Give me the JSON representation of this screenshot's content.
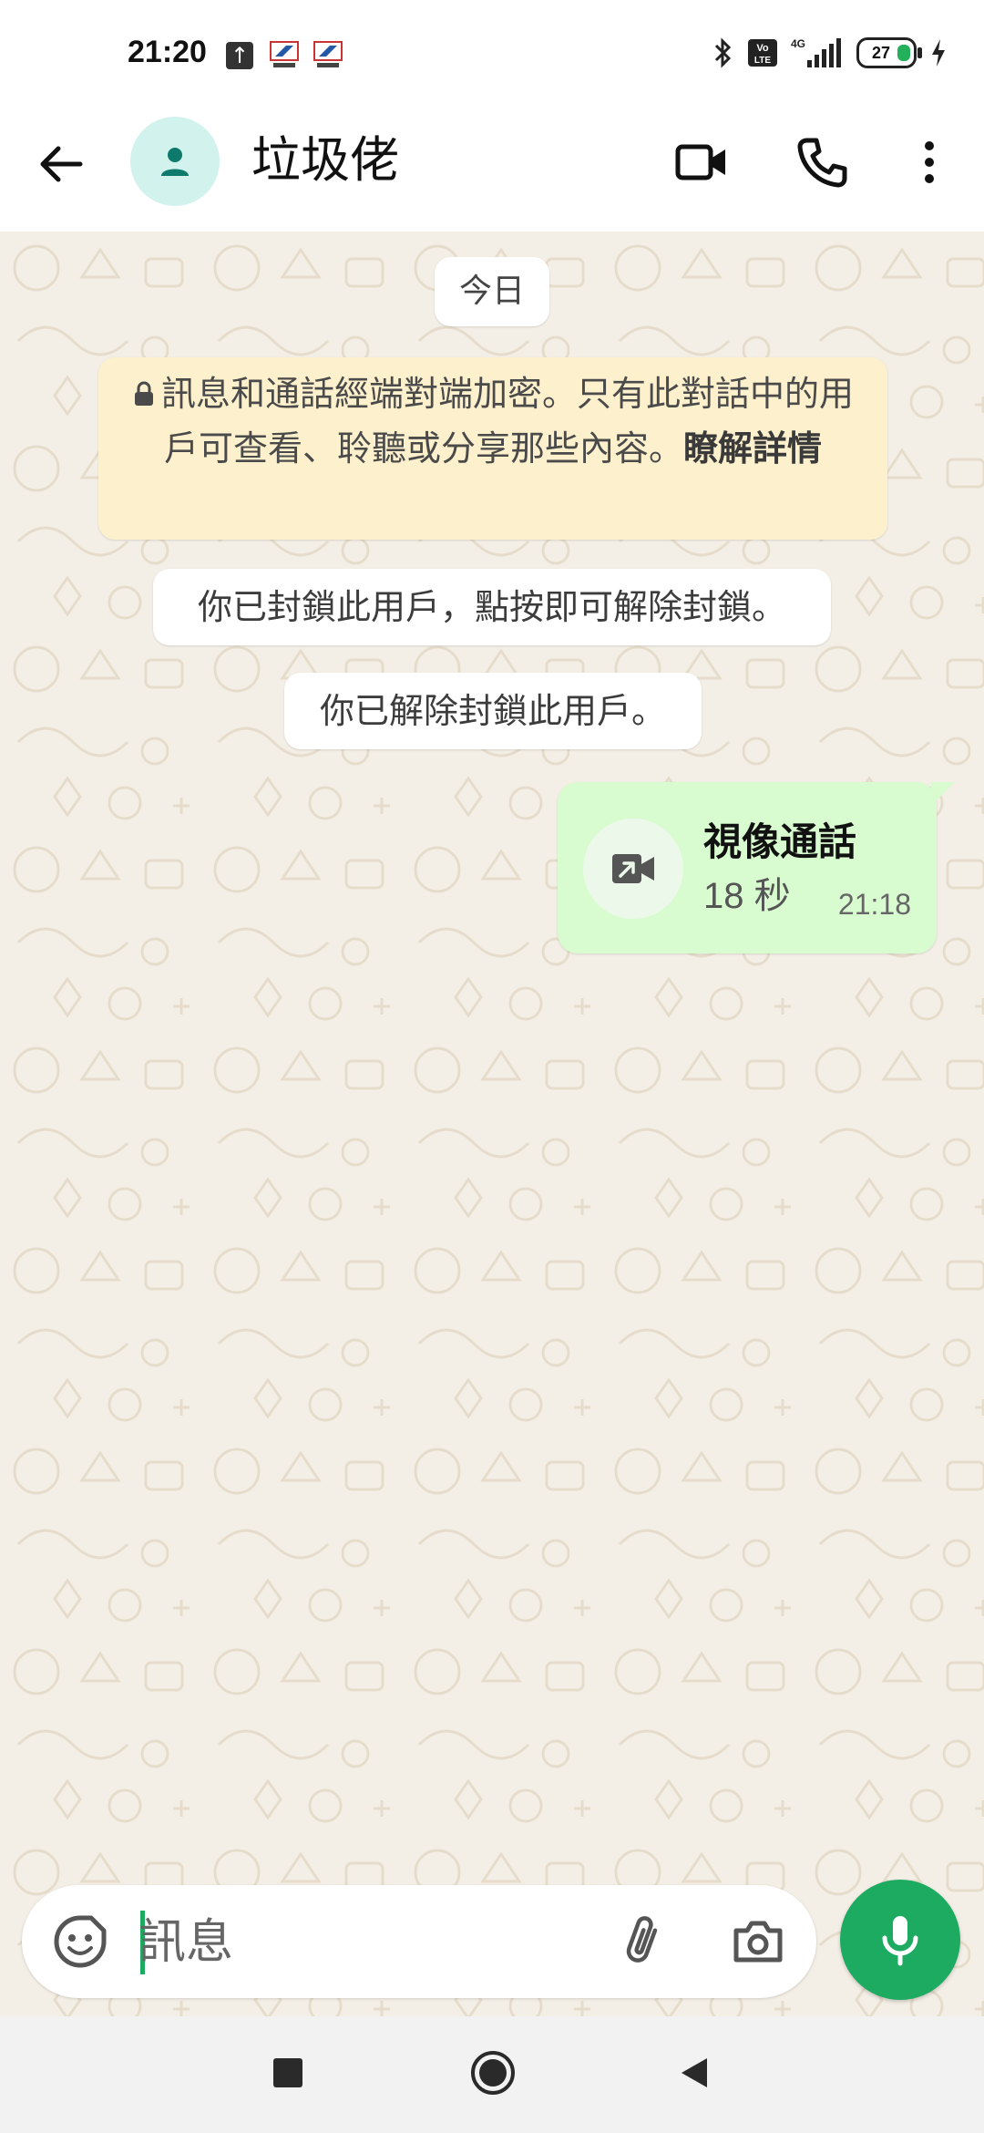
{
  "status_bar": {
    "time": "21:20",
    "battery": "27",
    "network": "4G",
    "volte": "Vo LTE"
  },
  "header": {
    "contact_name": "垃圾佬"
  },
  "chat": {
    "date_chip": "今日",
    "encryption_notice": {
      "text": "訊息和通話經端對端加密。只有此對話中的用戶可查看、聆聽或分享那些內容。",
      "link": "瞭解詳情"
    },
    "blocked_notice": "你已封鎖此用戶，點按即可解除封鎖。",
    "unblocked_notice": "你已解除封鎖此用戶。",
    "call_message": {
      "title": "視像通話",
      "duration": "18 秒",
      "time": "21:18"
    }
  },
  "input": {
    "placeholder": "訊息"
  },
  "colors": {
    "accent": "#1daa61",
    "chat_bg": "#f4efe6",
    "outgoing_bubble": "#d8fcd0",
    "notice_bg": "#fdf0cd"
  }
}
